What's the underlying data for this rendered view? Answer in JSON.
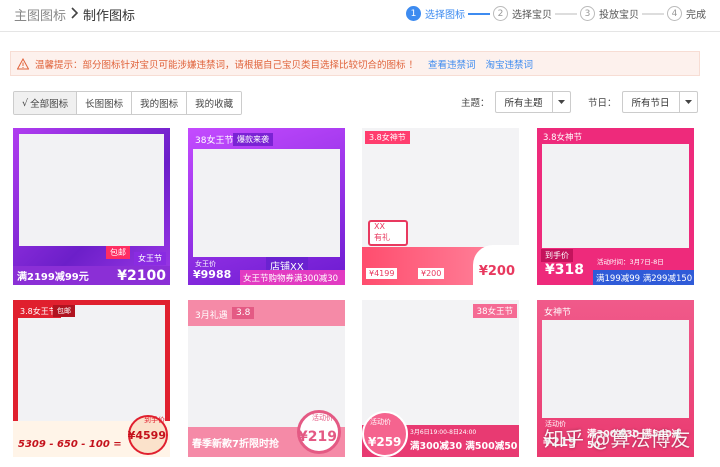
{
  "breadcrumb": {
    "parent": "主图图标",
    "current": "制作图标"
  },
  "steps": [
    {
      "num": "1",
      "label": "选择图标"
    },
    {
      "num": "2",
      "label": "选择宝贝"
    },
    {
      "num": "3",
      "label": "投放宝贝"
    },
    {
      "num": "4",
      "label": "完成"
    }
  ],
  "warning": {
    "text": "温馨提示：部分图标针对宝贝可能涉嫌违禁词，请根据自己宝贝类目选择比较切合的图标 ！",
    "link1": "查看违禁词",
    "link2": "淘宝违禁词"
  },
  "tabs": [
    {
      "check": "√",
      "label": "全部图标"
    },
    {
      "check": "",
      "label": "长图图标"
    },
    {
      "check": "",
      "label": "我的图标"
    },
    {
      "check": "",
      "label": "我的收藏"
    }
  ],
  "filters": {
    "theme_label": "主题：",
    "theme_value": "所有主题",
    "holiday_label": "节日：",
    "holiday_value": "所有节日"
  },
  "icons": [
    {
      "t1": "包邮",
      "t2": "女王节",
      "price": "¥2100",
      "banner": "满2199减99元"
    },
    {
      "t1": "38女王节",
      "t2": "爆款来袭",
      "t3": "店铺XX",
      "t4": "女王价",
      "price": "¥9988",
      "banner": "女王节购物券满300减30"
    },
    {
      "t1": "3.8女神节",
      "t2": "XX",
      "t3": "有礼",
      "t4": "¥4199",
      "t5": "¥200",
      "price": "¥200"
    },
    {
      "t1": "3.8女神节",
      "t2": "到手价",
      "t3": "活动时间：3月7日-8日",
      "price": "¥318",
      "banner": "满199减99 满299减150"
    },
    {
      "t1": "3.8女王节",
      "t2": "包邮",
      "t3": "到手价",
      "price": "¥4599",
      "banner": "5309 - 650 - 100 ="
    },
    {
      "t1": "3月礼遇",
      "t2": "3.8",
      "t3": "活动价",
      "price": "¥219",
      "banner": "春季新款7折限时抢"
    },
    {
      "t1": "38女王节",
      "t2": "活动价",
      "t3": "3月6日19:00-8日24:00",
      "price": "¥259",
      "banner": "满300减30 满500减50"
    },
    {
      "t1": "女神节",
      "t2": "活动价",
      "price": "¥219",
      "banner": "满300减30 满500减50"
    }
  ],
  "watermark": "知乎 @算法博友",
  "colors": {
    "accent": "#3d8bf0",
    "warning": "#e0623a",
    "pink": "#ef2f6d",
    "purple": "#8a2be2",
    "red": "#e02c3a"
  }
}
